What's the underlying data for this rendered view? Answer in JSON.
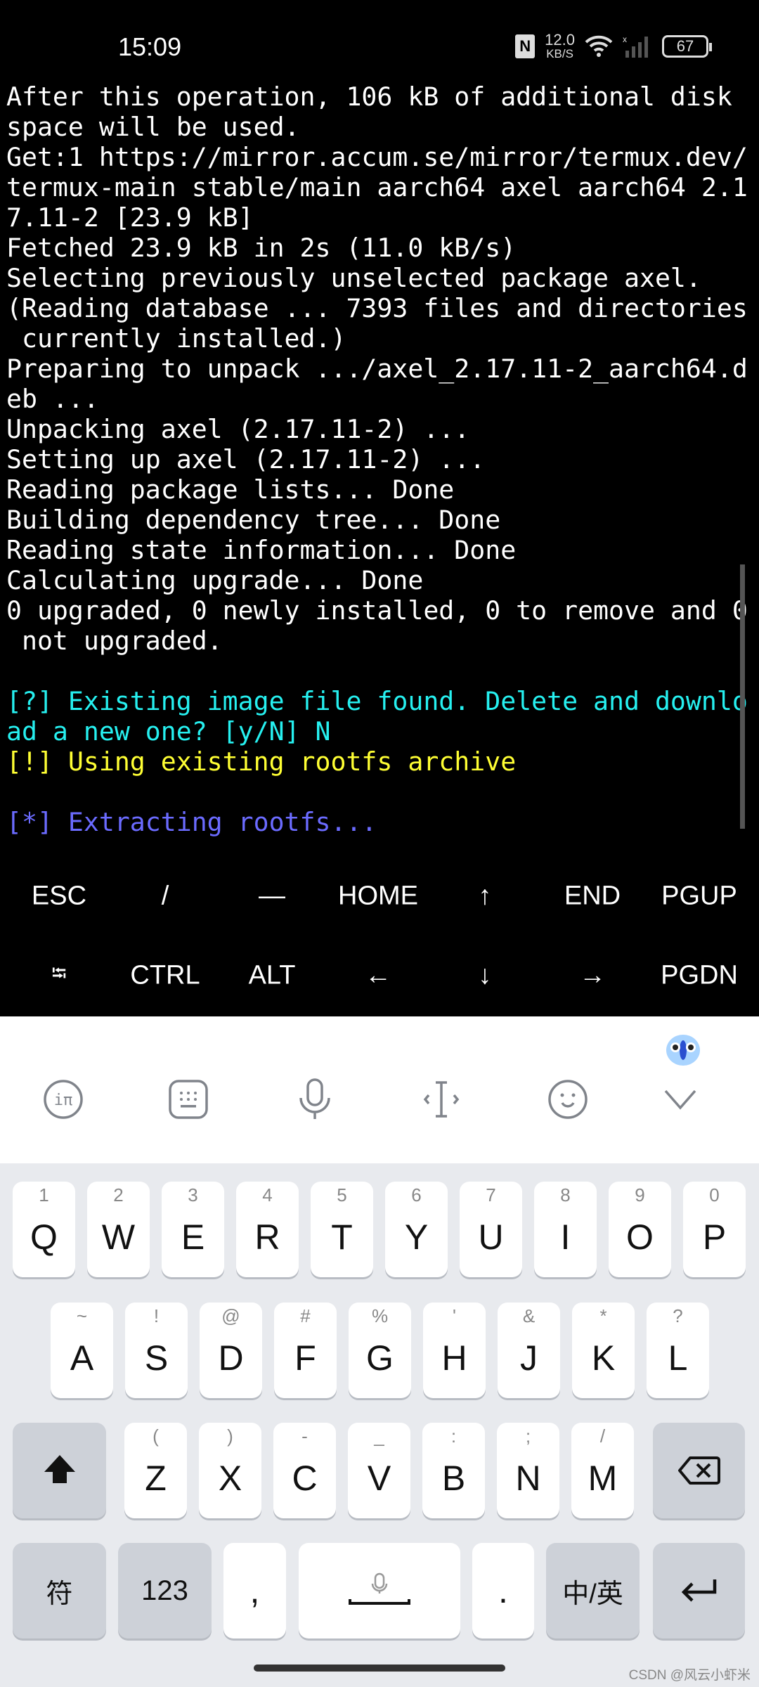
{
  "status": {
    "time": "15:09",
    "nfc": "N",
    "speed_value": "12.0",
    "speed_unit": "KB/S",
    "battery": "67"
  },
  "terminal": {
    "lines": [
      {
        "text": "After this operation, 106 kB of additional disk",
        "color": "white"
      },
      {
        "text": "space will be used.",
        "color": "white"
      },
      {
        "text": "Get:1 https://mirror.accum.se/mirror/termux.dev/",
        "color": "white"
      },
      {
        "text": "termux-main stable/main aarch64 axel aarch64 2.1",
        "color": "white"
      },
      {
        "text": "7.11-2 [23.9 kB]",
        "color": "white"
      },
      {
        "text": "Fetched 23.9 kB in 2s (11.0 kB/s)",
        "color": "white"
      },
      {
        "text": "Selecting previously unselected package axel.",
        "color": "white"
      },
      {
        "text": "(Reading database ... 7393 files and directories",
        "color": "white"
      },
      {
        "text": " currently installed.)",
        "color": "white"
      },
      {
        "text": "Preparing to unpack .../axel_2.17.11-2_aarch64.d",
        "color": "white"
      },
      {
        "text": "eb ...",
        "color": "white"
      },
      {
        "text": "Unpacking axel (2.17.11-2) ...",
        "color": "white"
      },
      {
        "text": "Setting up axel (2.17.11-2) ...",
        "color": "white"
      },
      {
        "text": "Reading package lists... Done",
        "color": "white"
      },
      {
        "text": "Building dependency tree... Done",
        "color": "white"
      },
      {
        "text": "Reading state information... Done",
        "color": "white"
      },
      {
        "text": "Calculating upgrade... Done",
        "color": "white"
      },
      {
        "text": "0 upgraded, 0 newly installed, 0 to remove and 0",
        "color": "white"
      },
      {
        "text": " not upgraded.",
        "color": "white"
      },
      {
        "text": "",
        "color": "white"
      },
      {
        "text": "[?] Existing image file found. Delete and downlo",
        "color": "cyan"
      },
      {
        "text": "ad a new one? [y/N] N",
        "color": "cyan"
      },
      {
        "text": "[!] Using existing rootfs archive",
        "color": "yellow"
      },
      {
        "text": "",
        "color": "white"
      },
      {
        "text": "[*] Extracting rootfs...",
        "color": "blue"
      }
    ]
  },
  "colors": {
    "cyan": "#26f0f0",
    "yellow": "#ffff33",
    "blue": "#6b6bff",
    "keyboard_bg": "#e8eaee"
  },
  "extra_keys": {
    "row1": [
      "ESC",
      "/",
      "—",
      "HOME",
      "↑",
      "END",
      "PGUP"
    ],
    "row2": [
      "⭾",
      "CTRL",
      "ALT",
      "←",
      "↓",
      "→",
      "PGDN"
    ]
  },
  "ime_toolbar": [
    "ime-logo-icon",
    "keyboard-icon",
    "microphone-icon",
    "cursor-icon",
    "emoji-icon",
    "chevron-down-icon"
  ],
  "keyboard": {
    "row1": [
      {
        "k": "Q",
        "s": "1"
      },
      {
        "k": "W",
        "s": "2"
      },
      {
        "k": "E",
        "s": "3"
      },
      {
        "k": "R",
        "s": "4"
      },
      {
        "k": "T",
        "s": "5"
      },
      {
        "k": "Y",
        "s": "6"
      },
      {
        "k": "U",
        "s": "7"
      },
      {
        "k": "I",
        "s": "8"
      },
      {
        "k": "O",
        "s": "9"
      },
      {
        "k": "P",
        "s": "0"
      }
    ],
    "row2": [
      {
        "k": "A",
        "s": "~"
      },
      {
        "k": "S",
        "s": "!"
      },
      {
        "k": "D",
        "s": "@"
      },
      {
        "k": "F",
        "s": "#"
      },
      {
        "k": "G",
        "s": "%"
      },
      {
        "k": "H",
        "s": "'"
      },
      {
        "k": "J",
        "s": "&"
      },
      {
        "k": "K",
        "s": "*"
      },
      {
        "k": "L",
        "s": "?"
      }
    ],
    "row3": [
      {
        "k": "Z",
        "s": "("
      },
      {
        "k": "X",
        "s": ")"
      },
      {
        "k": "C",
        "s": "-"
      },
      {
        "k": "V",
        "s": "_"
      },
      {
        "k": "B",
        "s": ":"
      },
      {
        "k": "N",
        "s": ";"
      },
      {
        "k": "M",
        "s": "/"
      }
    ],
    "symbols": "符",
    "numbers": "123",
    "comma": ",",
    "period": ".",
    "lang": "中/英"
  },
  "watermark": "CSDN @风云小虾米"
}
